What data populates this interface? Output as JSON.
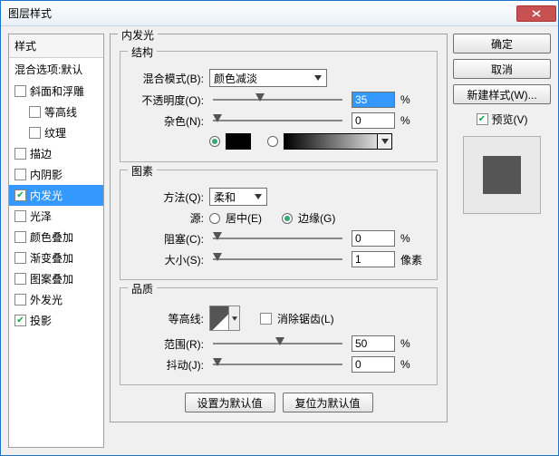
{
  "window": {
    "title": "图层样式"
  },
  "styles": {
    "header": "样式",
    "subheader": "混合选项:默认",
    "items": [
      {
        "label": "斜面和浮雕",
        "checked": false
      },
      {
        "label": "等高线",
        "checked": false,
        "indent": true
      },
      {
        "label": "纹理",
        "checked": false,
        "indent": true
      },
      {
        "label": "描边",
        "checked": false
      },
      {
        "label": "内阴影",
        "checked": false
      },
      {
        "label": "内发光",
        "checked": true,
        "selected": true
      },
      {
        "label": "光泽",
        "checked": false
      },
      {
        "label": "颜色叠加",
        "checked": false
      },
      {
        "label": "渐变叠加",
        "checked": false
      },
      {
        "label": "图案叠加",
        "checked": false
      },
      {
        "label": "外发光",
        "checked": false
      },
      {
        "label": "投影",
        "checked": true
      }
    ]
  },
  "panel": {
    "title": "内发光",
    "structure": {
      "legend": "结构",
      "blendmode_label": "混合模式(B):",
      "blendmode_value": "颜色减淡",
      "opacity_label": "不透明度(O):",
      "opacity_value": "35",
      "opacity_unit": "%",
      "noise_label": "杂色(N):",
      "noise_value": "0",
      "noise_unit": "%",
      "solid_color": "#000000"
    },
    "elements": {
      "legend": "图素",
      "technique_label": "方法(Q):",
      "technique_value": "柔和",
      "source_label": "源:",
      "source_center": "居中(E)",
      "source_edge": "边缘(G)",
      "choke_label": "阻塞(C):",
      "choke_value": "0",
      "choke_unit": "%",
      "size_label": "大小(S):",
      "size_value": "1",
      "size_unit": "像素"
    },
    "quality": {
      "legend": "品质",
      "contour_label": "等高线:",
      "antialias_label": "消除锯齿(L)",
      "range_label": "范围(R):",
      "range_value": "50",
      "range_unit": "%",
      "jitter_label": "抖动(J):",
      "jitter_value": "0",
      "jitter_unit": "%"
    },
    "buttons": {
      "make_default": "设置为默认值",
      "reset_default": "复位为默认值"
    }
  },
  "right": {
    "ok": "确定",
    "cancel": "取消",
    "new_style": "新建样式(W)...",
    "preview_label": "预览(V)"
  }
}
